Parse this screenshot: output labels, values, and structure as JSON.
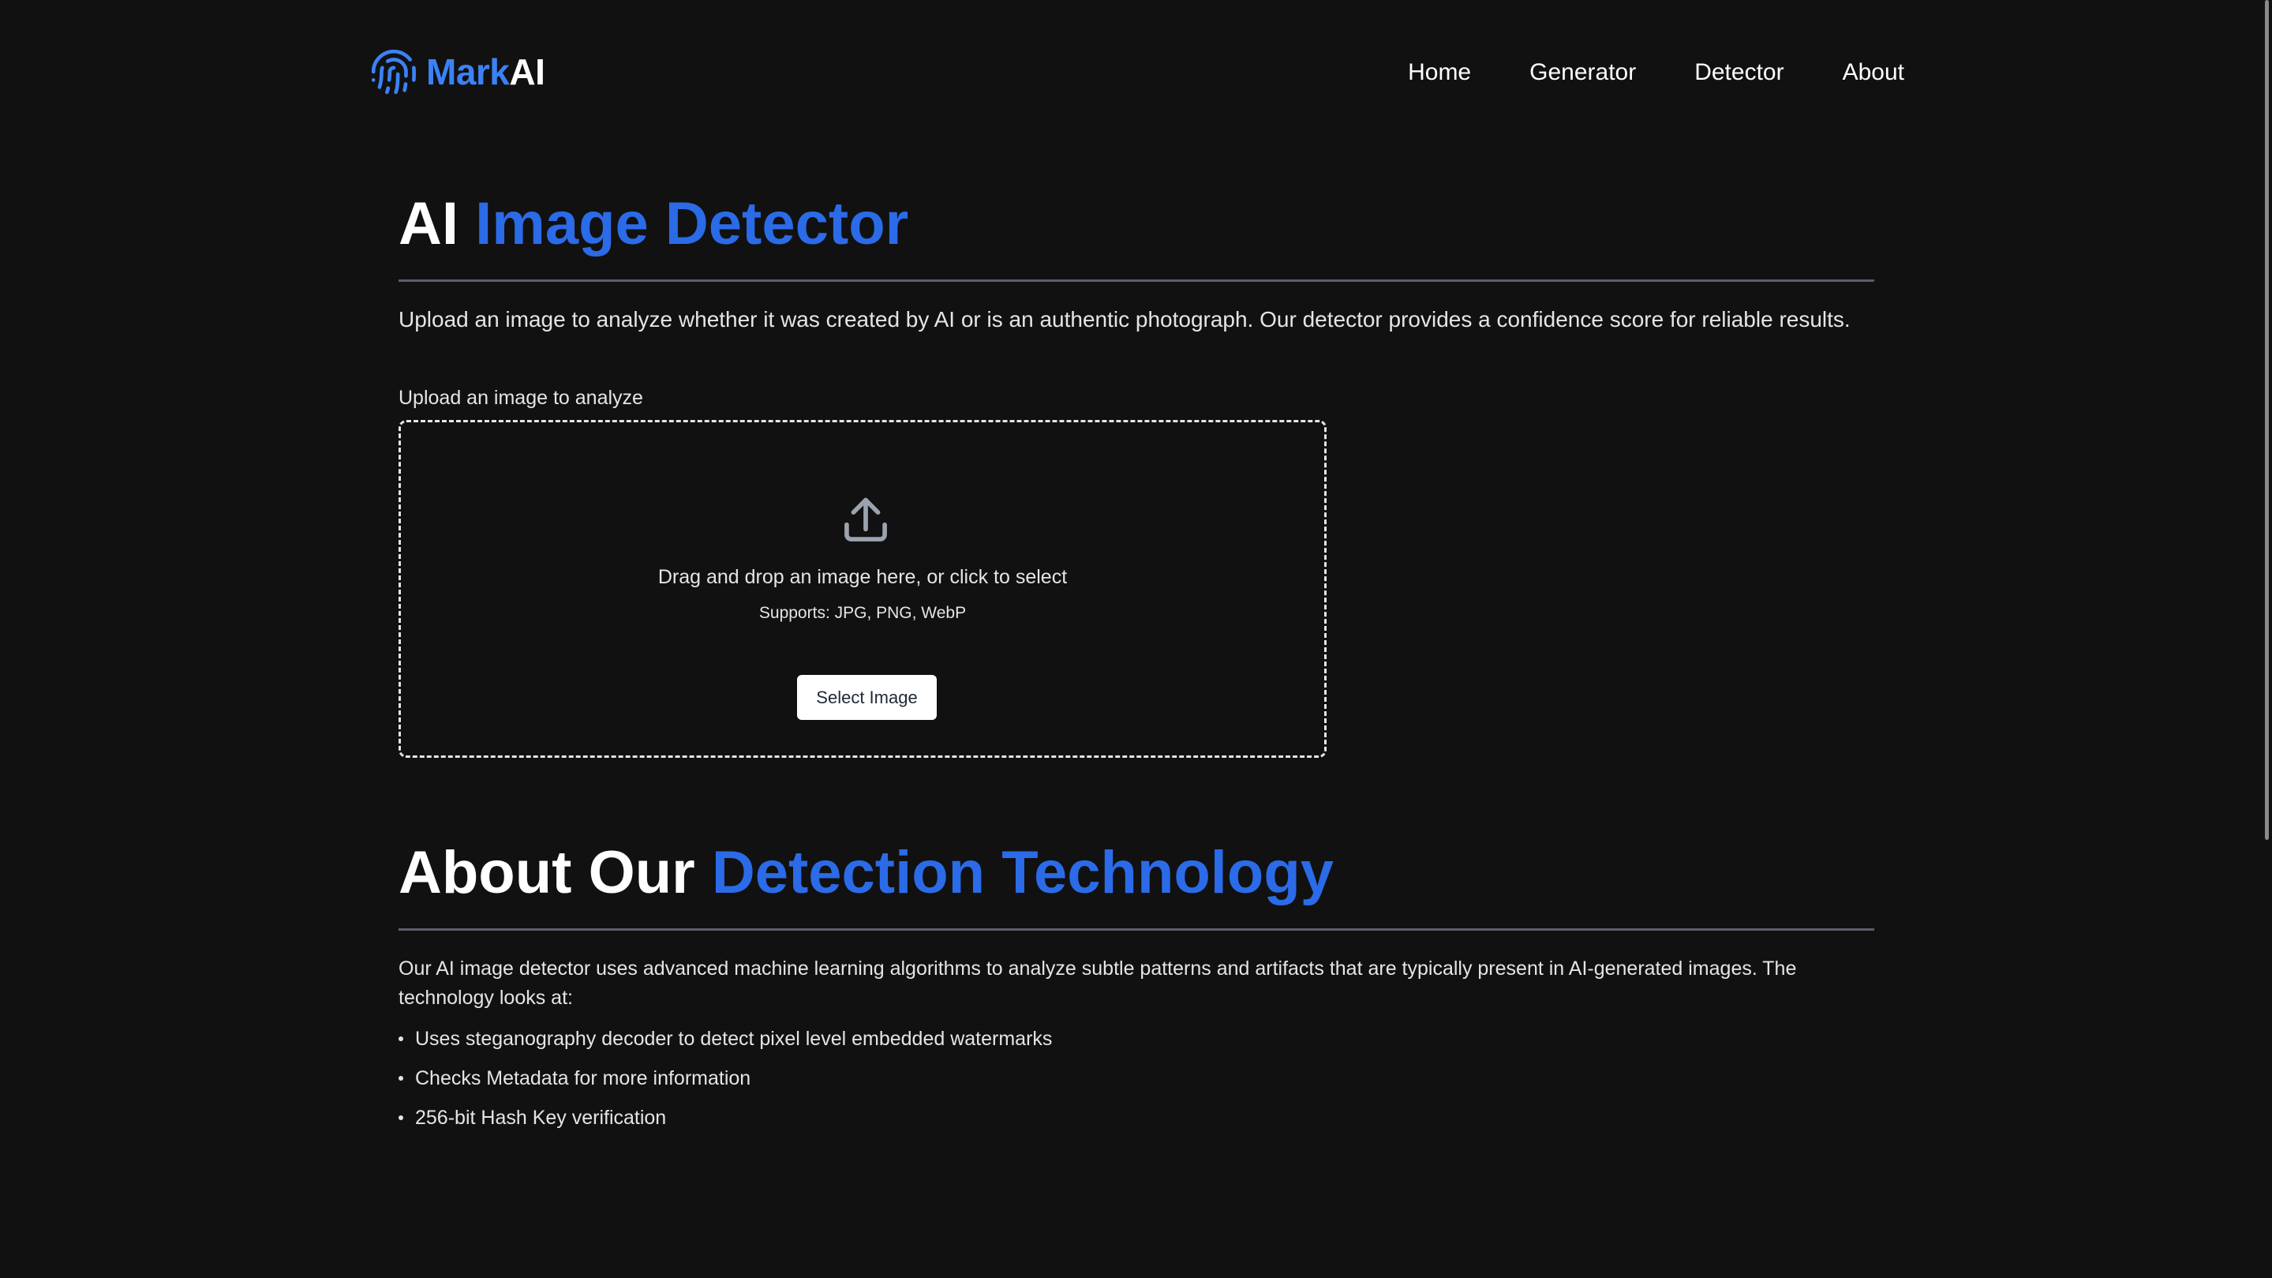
{
  "brand": {
    "name_part1": "Mark",
    "name_part2": "AI",
    "logo_icon": "fingerprint-icon",
    "accent_color": "#3b82f6"
  },
  "nav": {
    "items": [
      {
        "label": "Home"
      },
      {
        "label": "Generator"
      },
      {
        "label": "Detector"
      },
      {
        "label": "About"
      }
    ]
  },
  "hero": {
    "title_plain": "AI ",
    "title_accent": "Image Detector",
    "description": "Upload an image to analyze whether it was created by AI or is an authentic photograph. Our detector provides a confidence score for reliable results."
  },
  "upload": {
    "label": "Upload an image to analyze",
    "icon": "upload-icon",
    "drop_text": "Drag and drop an image here, or click to select",
    "supports_text": "Supports: JPG, PNG, WebP",
    "button_label": "Select Image"
  },
  "about": {
    "title_plain": "About Our ",
    "title_accent": "Detection Technology",
    "text": "Our AI image detector uses advanced machine learning algorithms to analyze subtle patterns and artifacts that are typically present in AI-generated images. The technology looks at:",
    "bullets": [
      "Uses steganography decoder to detect pixel level embedded watermarks",
      "Checks Metadata for more information",
      "256-bit Hash Key verification"
    ]
  }
}
